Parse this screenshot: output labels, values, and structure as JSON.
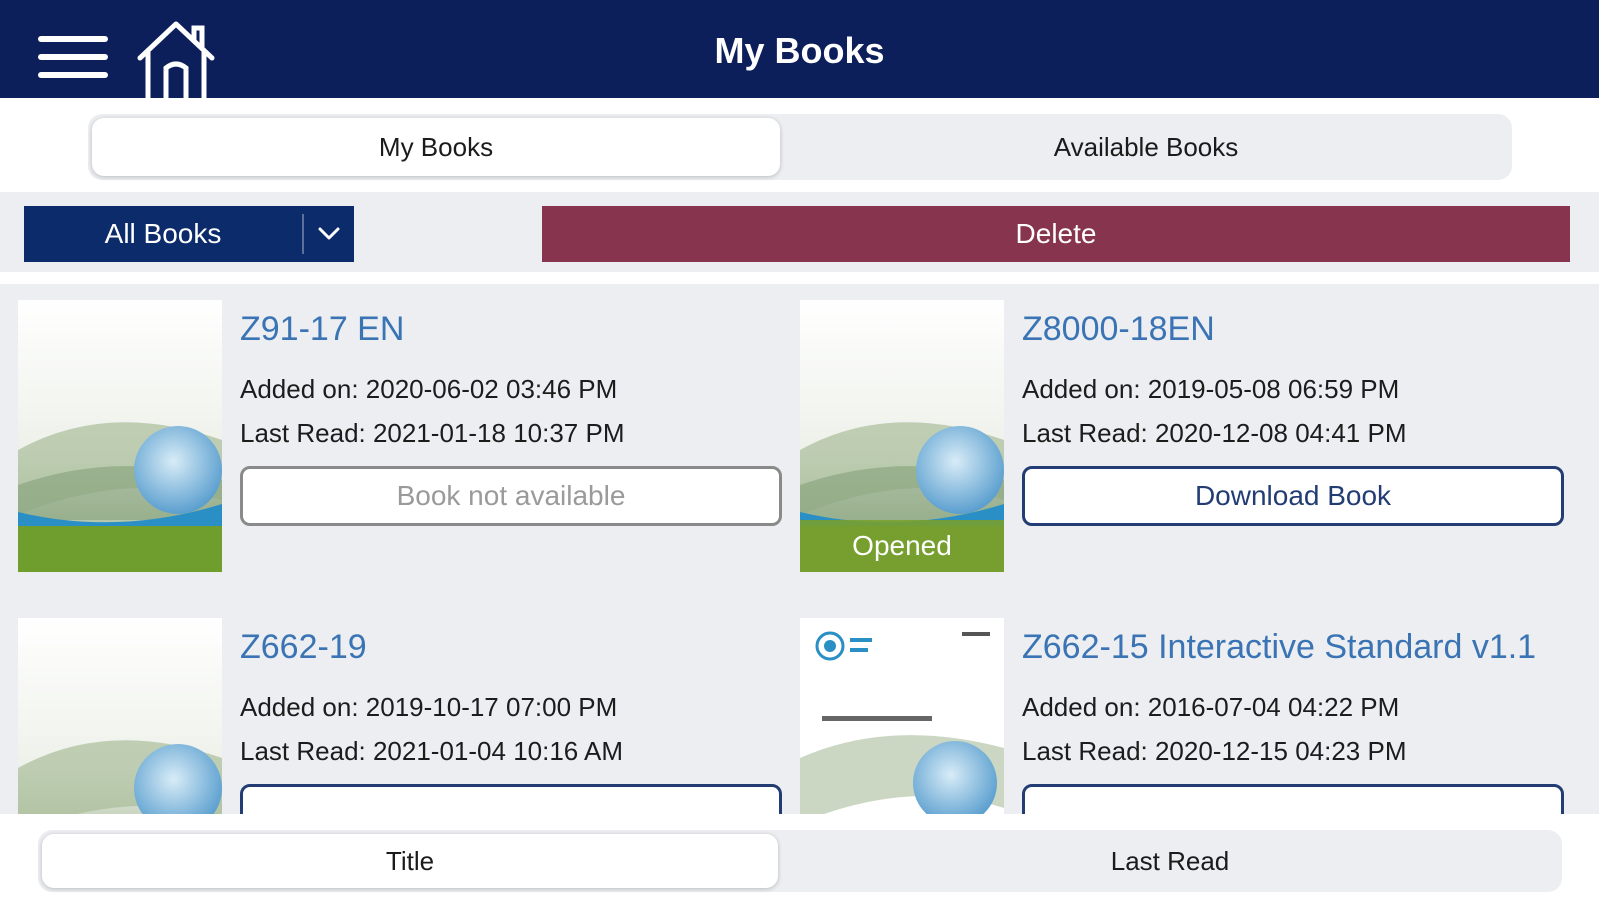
{
  "header": {
    "title": "My Books",
    "menu_icon": "hamburger-menu-icon",
    "home_icon": "home-icon"
  },
  "tabs": [
    {
      "label": "My Books",
      "active": true
    },
    {
      "label": "Available Books",
      "active": false
    }
  ],
  "filter": {
    "selected": "All Books",
    "icon": "chevron-down-icon"
  },
  "delete_label": "Delete",
  "books": [
    {
      "title": "Z91-17 EN",
      "added": "Added on: 2020-06-02 03:46 PM",
      "last_read": "Last Read: 2021-01-18 10:37 PM",
      "button": "Book not available",
      "badge": ""
    },
    {
      "title": "Z8000-18EN",
      "added": "Added on: 2019-05-08 06:59 PM",
      "last_read": "Last Read: 2020-12-08 04:41 PM",
      "button": "Download Book",
      "badge": "Opened"
    },
    {
      "title": "Z662-19",
      "added": "Added on: 2019-10-17 07:00 PM",
      "last_read": "Last Read: 2021-01-04 10:16 AM",
      "button": "",
      "badge": ""
    },
    {
      "title": "Z662-15 Interactive Standard v1.1",
      "added": "Added on: 2016-07-04 04:22 PM",
      "last_read": "Last Read: 2020-12-15 04:23 PM",
      "button": "",
      "badge": ""
    }
  ],
  "sort_tabs": [
    {
      "label": "Title",
      "active": true
    },
    {
      "label": "Last Read",
      "active": false
    }
  ],
  "colors": {
    "header_bg": "#0c1f5b",
    "filter_bg": "#0c2b6b",
    "delete_bg": "#87354e",
    "link_blue": "#3a74b4",
    "list_bg": "#eceef1",
    "badge_green": "#76a030"
  }
}
